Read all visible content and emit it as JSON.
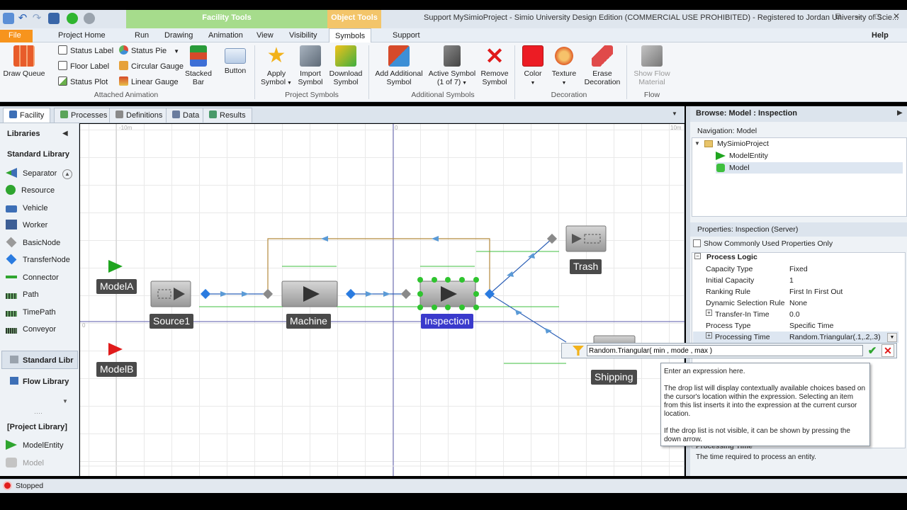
{
  "window": {
    "title": "Support  MySimioProject - Simio University Design Edition (COMMERCIAL USE PROHIBITED) - Registered to Jordan University of Scie...",
    "context_tab_facility": "Facility Tools",
    "context_tab_object": "Object Tools"
  },
  "menu": {
    "file": "File",
    "tabs": [
      "Project Home",
      "Run",
      "Drawing",
      "Animation",
      "View",
      "Visibility",
      "Symbols",
      "Support"
    ],
    "help": "Help"
  },
  "ribbon": {
    "draw_queue": "Draw Queue",
    "status_label": "Status Label",
    "floor_label": "Floor Label",
    "status_plot": "Status Plot",
    "status_pie": "Status Pie",
    "circular_gauge": "Circular Gauge",
    "linear_gauge": "Linear Gauge",
    "stacked_bar_1": "Stacked",
    "stacked_bar_2": "Bar",
    "button": "Button",
    "apply_symbol_1": "Apply",
    "apply_symbol_2": "Symbol",
    "import_symbol_1": "Import",
    "import_symbol_2": "Symbol",
    "download_symbol_1": "Download",
    "download_symbol_2": "Symbol",
    "add_symbol_1": "Add Additional",
    "add_symbol_2": "Symbol",
    "active_symbol_1": "Active Symbol",
    "active_symbol_2": "(1 of 7)",
    "remove_symbol_1": "Remove",
    "remove_symbol_2": "Symbol",
    "color": "Color",
    "texture": "Texture",
    "erase_1": "Erase",
    "erase_2": "Decoration",
    "show_flow_1": "Show Flow",
    "show_flow_2": "Material",
    "groups": {
      "attached_animation": "Attached Animation",
      "project_symbols": "Project Symbols",
      "additional_symbols": "Additional Symbols",
      "decoration": "Decoration",
      "flow": "Flow"
    }
  },
  "doc_tabs": [
    "Facility",
    "Processes",
    "Definitions",
    "Data",
    "Results"
  ],
  "libraries": {
    "header": "Libraries",
    "standard_library": "Standard Library",
    "items": [
      "Separator",
      "Resource",
      "Vehicle",
      "Worker",
      "BasicNode",
      "TransferNode",
      "Connector",
      "Path",
      "TimePath",
      "Conveyor"
    ],
    "standard_lib_tab": "Standard Libr",
    "flow_library": "Flow Library",
    "project_library": "[Project Library]",
    "project_items": [
      "ModelEntity",
      "Model"
    ]
  },
  "canvas": {
    "ruler_left": "-10m",
    "ruler_mid": "0",
    "ruler_right": "10m",
    "ruler_y": "0",
    "nodes": {
      "modela": "ModelA",
      "modelb": "ModelB",
      "source1": "Source1",
      "machine": "Machine",
      "inspection": "Inspection",
      "trash": "Trash",
      "shipping": "Shipping"
    },
    "colors": {
      "entity_a": "#1fa51f",
      "entity_b": "#e01b1b",
      "path": "#2b5fb6",
      "connector": "#b48a3c",
      "selection": "#2fc42f"
    }
  },
  "browse": {
    "header": "Browse: Model : Inspection",
    "navigation_label": "Navigation: Model",
    "tree": [
      "MySimioProject",
      "ModelEntity",
      "Model"
    ]
  },
  "properties": {
    "header": "Properties: Inspection (Server)",
    "common_only": "Show Commonly Used Properties Only",
    "category": "Process Logic",
    "rows": [
      {
        "name": "Capacity Type",
        "value": "Fixed"
      },
      {
        "name": "Initial Capacity",
        "value": "1"
      },
      {
        "name": "Ranking Rule",
        "value": "First In First Out"
      },
      {
        "name": "Dynamic Selection Rule",
        "value": "None"
      },
      {
        "name": "Transfer-In Time",
        "value": "0.0"
      },
      {
        "name": "Process Type",
        "value": "Specific Time"
      },
      {
        "name": "Processing Time",
        "value": "Random.Triangular(.1,.2,.3)"
      }
    ],
    "desc_title": "Processing Time",
    "desc_text": "The time required to process an entity."
  },
  "expression": {
    "value": "Random.Triangular( min , mode , max )",
    "tooltip_1": "Enter an expression here.",
    "tooltip_2": "The drop list will display contextually available choices based on the cursor's location within the expression.  Selecting an item from this list inserts it into the expression at the current cursor location.",
    "tooltip_3": "If the drop list is not visible, it can be shown by pressing the down arrow."
  },
  "status": {
    "text": "Stopped"
  }
}
